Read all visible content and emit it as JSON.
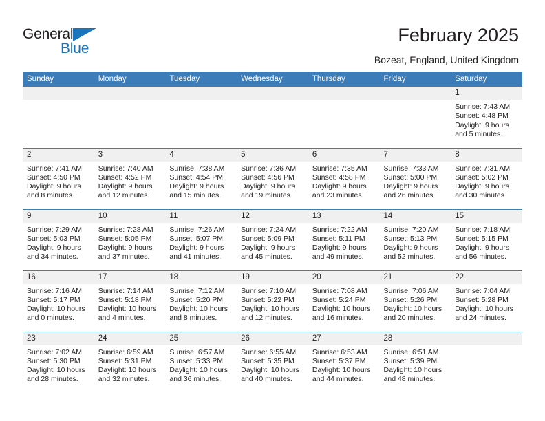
{
  "logo": {
    "word_one": "General",
    "word_two": "Blue",
    "triangle_icon": "triangle-icon",
    "accent_color": "#1b75bc"
  },
  "header": {
    "title": "February 2025",
    "subtitle": "Bozeat, England, United Kingdom"
  },
  "calendar": {
    "header_color": "#3b7cb9",
    "daynum_band_color": "#f0f0f0",
    "weekday_headers": [
      "Sunday",
      "Monday",
      "Tuesday",
      "Wednesday",
      "Thursday",
      "Friday",
      "Saturday"
    ],
    "weeks": [
      [
        {
          "day": "",
          "sunrise": "",
          "sunset": "",
          "daylight": "",
          "empty": true
        },
        {
          "day": "",
          "sunrise": "",
          "sunset": "",
          "daylight": "",
          "empty": true
        },
        {
          "day": "",
          "sunrise": "",
          "sunset": "",
          "daylight": "",
          "empty": true
        },
        {
          "day": "",
          "sunrise": "",
          "sunset": "",
          "daylight": "",
          "empty": true
        },
        {
          "day": "",
          "sunrise": "",
          "sunset": "",
          "daylight": "",
          "empty": true
        },
        {
          "day": "",
          "sunrise": "",
          "sunset": "",
          "daylight": "",
          "empty": true
        },
        {
          "day": "1",
          "sunrise": "Sunrise: 7:43 AM",
          "sunset": "Sunset: 4:48 PM",
          "daylight": "Daylight: 9 hours and 5 minutes."
        }
      ],
      [
        {
          "day": "2",
          "sunrise": "Sunrise: 7:41 AM",
          "sunset": "Sunset: 4:50 PM",
          "daylight": "Daylight: 9 hours and 8 minutes."
        },
        {
          "day": "3",
          "sunrise": "Sunrise: 7:40 AM",
          "sunset": "Sunset: 4:52 PM",
          "daylight": "Daylight: 9 hours and 12 minutes."
        },
        {
          "day": "4",
          "sunrise": "Sunrise: 7:38 AM",
          "sunset": "Sunset: 4:54 PM",
          "daylight": "Daylight: 9 hours and 15 minutes."
        },
        {
          "day": "5",
          "sunrise": "Sunrise: 7:36 AM",
          "sunset": "Sunset: 4:56 PM",
          "daylight": "Daylight: 9 hours and 19 minutes."
        },
        {
          "day": "6",
          "sunrise": "Sunrise: 7:35 AM",
          "sunset": "Sunset: 4:58 PM",
          "daylight": "Daylight: 9 hours and 23 minutes."
        },
        {
          "day": "7",
          "sunrise": "Sunrise: 7:33 AM",
          "sunset": "Sunset: 5:00 PM",
          "daylight": "Daylight: 9 hours and 26 minutes."
        },
        {
          "day": "8",
          "sunrise": "Sunrise: 7:31 AM",
          "sunset": "Sunset: 5:02 PM",
          "daylight": "Daylight: 9 hours and 30 minutes."
        }
      ],
      [
        {
          "day": "9",
          "sunrise": "Sunrise: 7:29 AM",
          "sunset": "Sunset: 5:03 PM",
          "daylight": "Daylight: 9 hours and 34 minutes."
        },
        {
          "day": "10",
          "sunrise": "Sunrise: 7:28 AM",
          "sunset": "Sunset: 5:05 PM",
          "daylight": "Daylight: 9 hours and 37 minutes."
        },
        {
          "day": "11",
          "sunrise": "Sunrise: 7:26 AM",
          "sunset": "Sunset: 5:07 PM",
          "daylight": "Daylight: 9 hours and 41 minutes."
        },
        {
          "day": "12",
          "sunrise": "Sunrise: 7:24 AM",
          "sunset": "Sunset: 5:09 PM",
          "daylight": "Daylight: 9 hours and 45 minutes."
        },
        {
          "day": "13",
          "sunrise": "Sunrise: 7:22 AM",
          "sunset": "Sunset: 5:11 PM",
          "daylight": "Daylight: 9 hours and 49 minutes."
        },
        {
          "day": "14",
          "sunrise": "Sunrise: 7:20 AM",
          "sunset": "Sunset: 5:13 PM",
          "daylight": "Daylight: 9 hours and 52 minutes."
        },
        {
          "day": "15",
          "sunrise": "Sunrise: 7:18 AM",
          "sunset": "Sunset: 5:15 PM",
          "daylight": "Daylight: 9 hours and 56 minutes."
        }
      ],
      [
        {
          "day": "16",
          "sunrise": "Sunrise: 7:16 AM",
          "sunset": "Sunset: 5:17 PM",
          "daylight": "Daylight: 10 hours and 0 minutes."
        },
        {
          "day": "17",
          "sunrise": "Sunrise: 7:14 AM",
          "sunset": "Sunset: 5:18 PM",
          "daylight": "Daylight: 10 hours and 4 minutes."
        },
        {
          "day": "18",
          "sunrise": "Sunrise: 7:12 AM",
          "sunset": "Sunset: 5:20 PM",
          "daylight": "Daylight: 10 hours and 8 minutes."
        },
        {
          "day": "19",
          "sunrise": "Sunrise: 7:10 AM",
          "sunset": "Sunset: 5:22 PM",
          "daylight": "Daylight: 10 hours and 12 minutes."
        },
        {
          "day": "20",
          "sunrise": "Sunrise: 7:08 AM",
          "sunset": "Sunset: 5:24 PM",
          "daylight": "Daylight: 10 hours and 16 minutes."
        },
        {
          "day": "21",
          "sunrise": "Sunrise: 7:06 AM",
          "sunset": "Sunset: 5:26 PM",
          "daylight": "Daylight: 10 hours and 20 minutes."
        },
        {
          "day": "22",
          "sunrise": "Sunrise: 7:04 AM",
          "sunset": "Sunset: 5:28 PM",
          "daylight": "Daylight: 10 hours and 24 minutes."
        }
      ],
      [
        {
          "day": "23",
          "sunrise": "Sunrise: 7:02 AM",
          "sunset": "Sunset: 5:30 PM",
          "daylight": "Daylight: 10 hours and 28 minutes."
        },
        {
          "day": "24",
          "sunrise": "Sunrise: 6:59 AM",
          "sunset": "Sunset: 5:31 PM",
          "daylight": "Daylight: 10 hours and 32 minutes."
        },
        {
          "day": "25",
          "sunrise": "Sunrise: 6:57 AM",
          "sunset": "Sunset: 5:33 PM",
          "daylight": "Daylight: 10 hours and 36 minutes."
        },
        {
          "day": "26",
          "sunrise": "Sunrise: 6:55 AM",
          "sunset": "Sunset: 5:35 PM",
          "daylight": "Daylight: 10 hours and 40 minutes."
        },
        {
          "day": "27",
          "sunrise": "Sunrise: 6:53 AM",
          "sunset": "Sunset: 5:37 PM",
          "daylight": "Daylight: 10 hours and 44 minutes."
        },
        {
          "day": "28",
          "sunrise": "Sunrise: 6:51 AM",
          "sunset": "Sunset: 5:39 PM",
          "daylight": "Daylight: 10 hours and 48 minutes."
        },
        {
          "day": "",
          "sunrise": "",
          "sunset": "",
          "daylight": "",
          "empty": true
        }
      ]
    ]
  }
}
